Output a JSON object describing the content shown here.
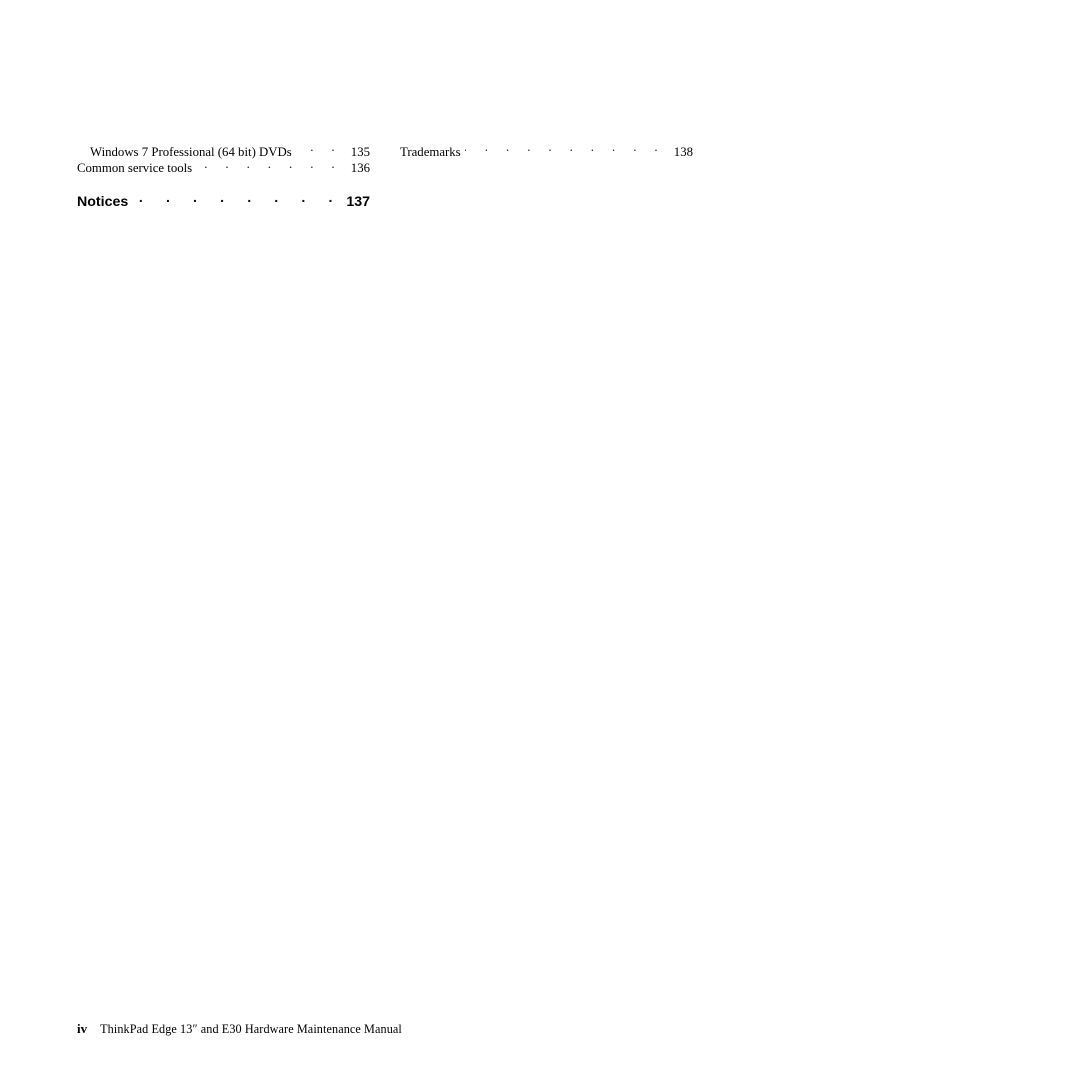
{
  "document": {
    "type": "table-of-contents-continuation",
    "background_color": "#ffffff",
    "text_color": "#000000"
  },
  "toc": {
    "left_column": [
      {
        "title": "Windows 7 Professional (64 bit) DVDs",
        "page": "135",
        "indent": 1,
        "style": "normal",
        "leader_dots": ". . . . ."
      },
      {
        "title": "Common service tools",
        "page": "136",
        "indent": 0,
        "style": "normal",
        "leader_dots": ". . . . . . . . . . ."
      },
      {
        "title": "Notices",
        "page": "137",
        "indent": 0,
        "style": "bold-heading",
        "leader_dots": ". . . . . . . . . . . . . ."
      }
    ],
    "right_column": [
      {
        "title": "Trademarks",
        "page": "138",
        "indent": 0,
        "style": "normal",
        "leader_dots": ". . . . . . . . . . . . . ."
      }
    ]
  },
  "footer": {
    "page_number": "iv",
    "title": "ThinkPad Edge 13″ and E30 Hardware Maintenance Manual"
  }
}
